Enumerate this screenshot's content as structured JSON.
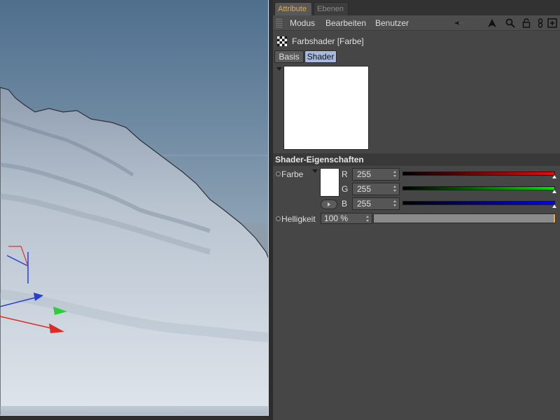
{
  "tabs": {
    "attribute": "Attribute",
    "ebenen": "Ebenen"
  },
  "menu": {
    "modus": "Modus",
    "bearbeiten": "Bearbeiten",
    "benutzer": "Benutzer"
  },
  "toolbar_icons": [
    "arrow-back-icon",
    "arrow-up-icon",
    "search-icon",
    "lock-icon",
    "link-icon",
    "new-panel-icon"
  ],
  "object": {
    "title": "Farbshader [Farbe]",
    "icon": "checkerboard-icon"
  },
  "subtabs": {
    "basis": "Basis",
    "shader": "Shader",
    "active": "Shader"
  },
  "section": {
    "title": "Shader-Eigenschaften"
  },
  "farbe": {
    "label": "Farbe",
    "swatch_color": "#ffffff",
    "channels": [
      {
        "label": "R",
        "value": "255",
        "gradient_end": "#ff0000"
      },
      {
        "label": "G",
        "value": "255",
        "gradient_end": "#00e000"
      },
      {
        "label": "B",
        "value": "255",
        "gradient_end": "#0000ff"
      }
    ]
  },
  "helligkeit": {
    "label": "Helligkeit",
    "value": "100 %",
    "level": 1.0
  },
  "colors": {
    "accent": "#f0a830",
    "active_subtab": "#a7b9dd",
    "panel_bg": "#464646"
  }
}
